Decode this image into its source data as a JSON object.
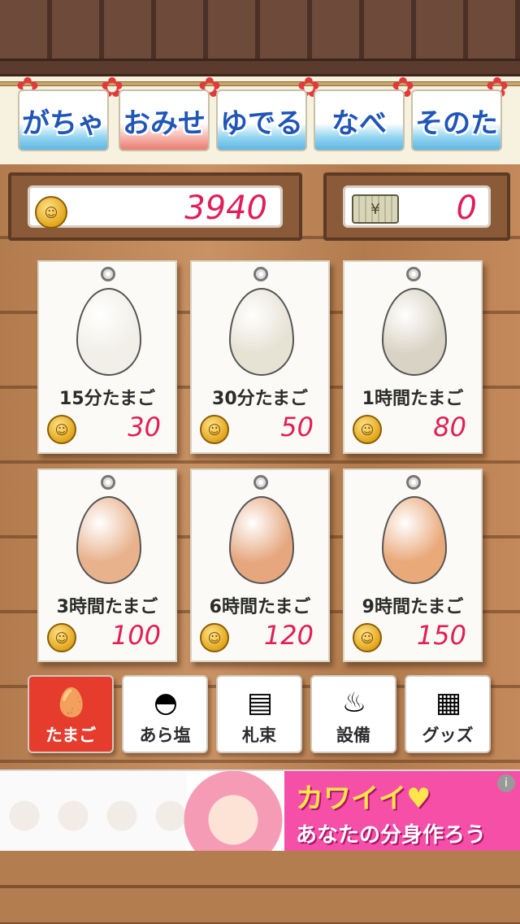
{
  "tabs": [
    {
      "label": "がちゃ",
      "active": false
    },
    {
      "label": "おみせ",
      "active": true
    },
    {
      "label": "ゆでる",
      "active": false
    },
    {
      "label": "なべ",
      "active": false
    },
    {
      "label": "そのた",
      "active": false
    }
  ],
  "currency": {
    "coins": "3940",
    "bills": "0"
  },
  "eggs": [
    {
      "name": "15分たまご",
      "price": "30",
      "color": "#f1efe8"
    },
    {
      "name": "30分たまご",
      "price": "50",
      "color": "#e6e2d4"
    },
    {
      "name": "1時間たまご",
      "price": "80",
      "color": "#d8d3c4"
    },
    {
      "name": "3時間たまご",
      "price": "100",
      "color": "#e8b28c"
    },
    {
      "name": "6時間たまご",
      "price": "120",
      "color": "#e6a77f"
    },
    {
      "name": "9時間たまご",
      "price": "150",
      "color": "#e9a979"
    }
  ],
  "tools": [
    {
      "label": "たまご",
      "active": true,
      "icon": "egg-basket-icon"
    },
    {
      "label": "あら塩",
      "active": false,
      "icon": "salt-bowl-icon"
    },
    {
      "label": "札束",
      "active": false,
      "icon": "money-bundle-icon"
    },
    {
      "label": "設備",
      "active": false,
      "icon": "pot-icon"
    },
    {
      "label": "グッズ",
      "active": false,
      "icon": "goods-cards-icon"
    }
  ],
  "ad": {
    "line1": "カワイイ♥",
    "line2": "あなたの分身作ろう",
    "info": "i"
  },
  "colors": {
    "price": "#e01e5a",
    "tab_text": "#1f56b8",
    "active_tool": "#e53c2e"
  }
}
